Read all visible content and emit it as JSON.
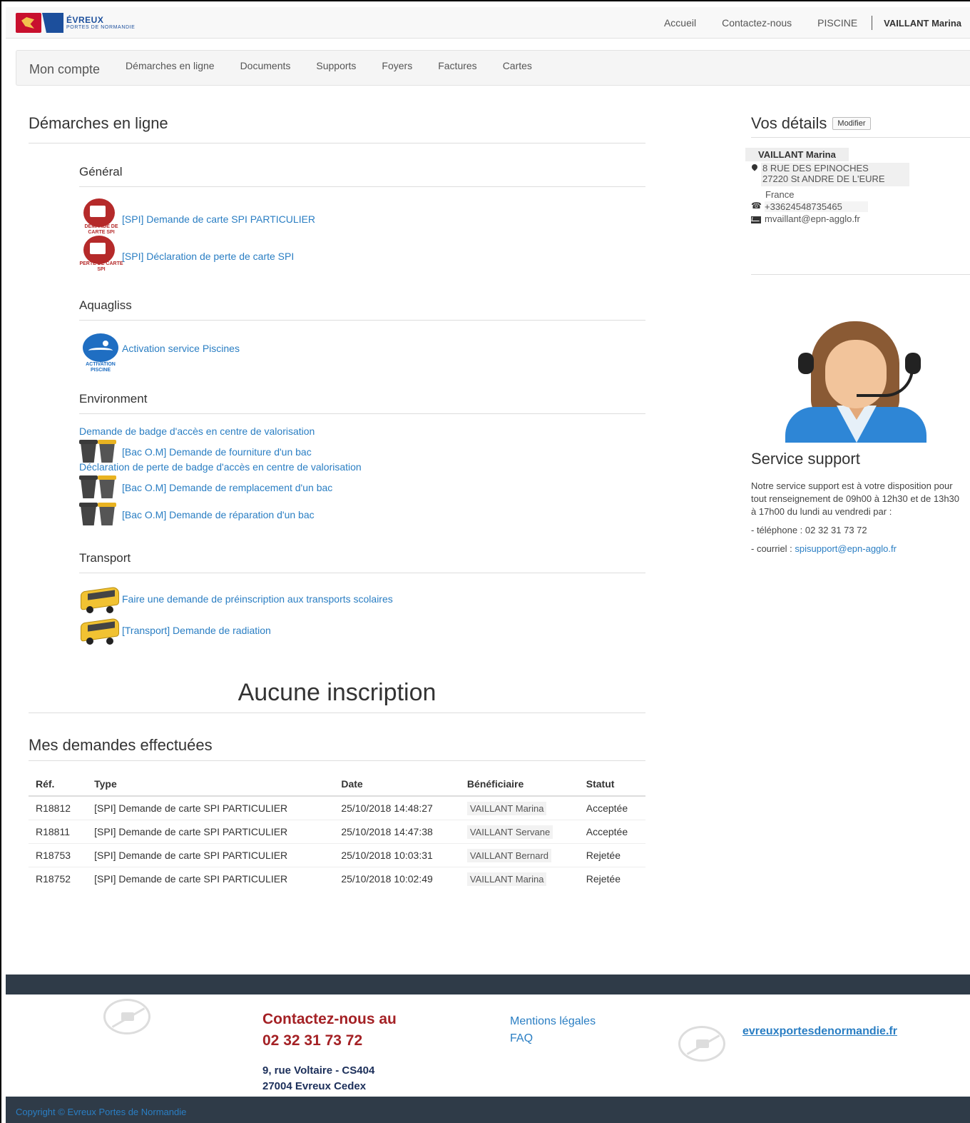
{
  "brand": {
    "name": "ÉVREUX",
    "sub": "PORTES DE NORMANDIE"
  },
  "topnav": {
    "home": "Accueil",
    "contact": "Contactez-nous",
    "pool": "PISCINE",
    "user": "VAILLANT Marina"
  },
  "subnav": {
    "brand": "Mon compte",
    "items": [
      "Démarches en ligne",
      "Documents",
      "Supports",
      "Foyers",
      "Factures",
      "Cartes"
    ]
  },
  "main": {
    "title": "Démarches en ligne",
    "categories": [
      {
        "name": "Général",
        "services": [
          {
            "label": "[SPI] Demande de carte SPI PARTICULIER",
            "icon": "spi-card-request-icon",
            "caption": "DEMANDE DE CARTE SPI"
          },
          {
            "label": "[SPI] Déclaration de perte de carte SPI",
            "icon": "spi-card-lost-icon",
            "caption": "PERTE DE CARTE SPI"
          }
        ]
      },
      {
        "name": "Aquagliss",
        "services": [
          {
            "label": "Activation service Piscines",
            "icon": "pool-activation-icon",
            "caption": "ACTIVATION PISCINE"
          }
        ]
      },
      {
        "name": "Environment",
        "services": [
          {
            "label": "Demande de badge d'accès en centre de valorisation"
          },
          {
            "label": "[Bac O.M] Demande de fourniture d'un bac",
            "icon": "waste-bins-icon"
          },
          {
            "label": "Déclaration de perte de badge d'accès en centre de valorisation"
          },
          {
            "label": "[Bac O.M] Demande de remplacement d'un bac",
            "icon": "waste-bins-icon"
          },
          {
            "label": "[Bac O.M] Demande de réparation d'un bac",
            "icon": "waste-bins-icon"
          }
        ]
      },
      {
        "name": "Transport",
        "services": [
          {
            "label": "Faire une demande de préinscription aux transports scolaires",
            "icon": "school-bus-icon"
          },
          {
            "label": "[Transport] Demande de radiation",
            "icon": "school-bus-icon"
          }
        ]
      }
    ],
    "no_registration": "Aucune inscription",
    "requests_title": "Mes demandes effectuées",
    "table": {
      "headers": [
        "Réf.",
        "Type",
        "Date",
        "Bénéficiaire",
        "Statut"
      ],
      "rows": [
        [
          "R18812",
          "[SPI] Demande de carte SPI PARTICULIER",
          "25/10/2018 14:48:27",
          "VAILLANT Marina",
          "Acceptée"
        ],
        [
          "R18811",
          "[SPI] Demande de carte SPI PARTICULIER",
          "25/10/2018 14:47:38",
          "VAILLANT Servane",
          "Acceptée"
        ],
        [
          "R18753",
          "[SPI] Demande de carte SPI PARTICULIER",
          "25/10/2018 10:03:31",
          "VAILLANT Bernard",
          "Rejetée"
        ],
        [
          "R18752",
          "[SPI] Demande de carte SPI PARTICULIER",
          "25/10/2018 10:02:49",
          "VAILLANT Marina",
          "Rejetée"
        ]
      ]
    }
  },
  "sidebar": {
    "title": "Vos détails",
    "edit_label": "Modifier",
    "name": "VAILLANT Marina",
    "address1": "8 RUE DES EPINOCHES",
    "address2": "27220 St ANDRE DE L'EURE",
    "country": "France",
    "phone": "+33624548735465",
    "email": "mvaillant@epn-agglo.fr",
    "support_title": "Service support",
    "support_text": "Notre service support est à votre disposition pour tout renseignement de 09h00 à 12h30 et de 13h30 à 17h00 du lundi au vendredi par :",
    "support_phone": "- téléphone : 02 32 31 73 72",
    "support_mail_prefix": "- courriel : ",
    "support_mail": "spisupport@epn-agglo.fr"
  },
  "footer": {
    "contact_line1": "Contactez-nous au",
    "contact_phone": "02 32 31 73 72",
    "address1": "9, rue Voltaire - CS404",
    "address2": "27004 Evreux Cedex",
    "legal": "Mentions légales",
    "faq": "FAQ",
    "website": "evreuxportesdenormandie.fr",
    "copyright": "Copyright © Evreux Portes de Normandie"
  },
  "colors": {
    "link": "#2a7ec3",
    "footer_dark": "#2f3b48",
    "footer_red": "#a42125"
  }
}
